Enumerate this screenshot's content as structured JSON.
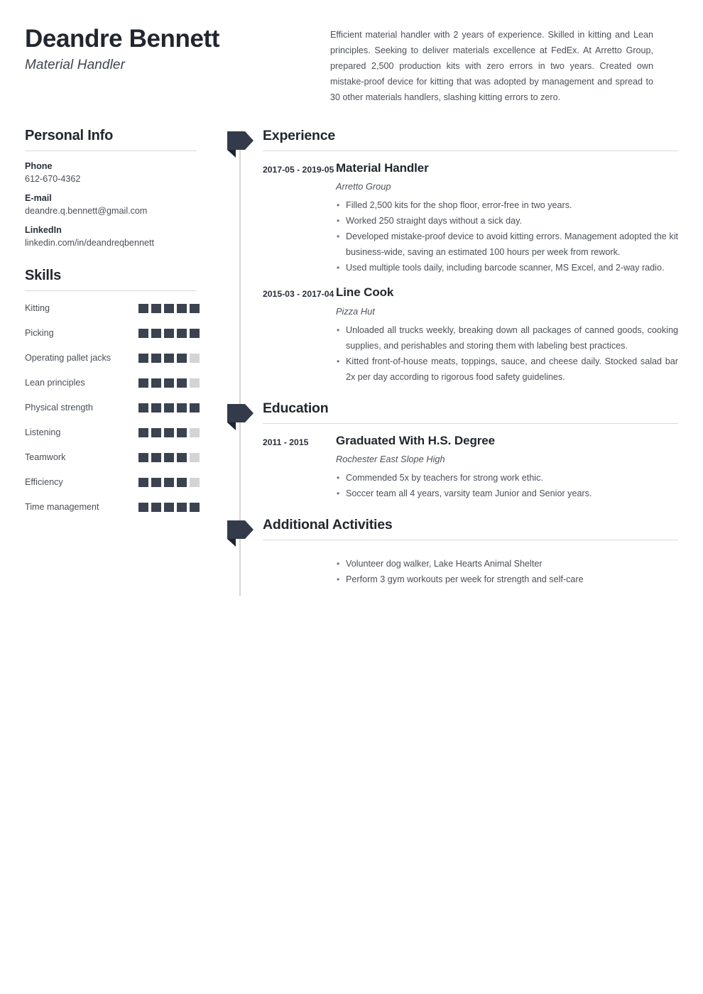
{
  "header": {
    "name": "Deandre Bennett",
    "job_title": "Material Handler",
    "summary": "Efficient material handler with 2 years of experience. Skilled in kitting and Lean principles. Seeking to deliver materials excellence at FedEx. At Arretto Group, prepared 2,500 production kits with zero errors in two years. Created own mistake-proof device for kitting that was adopted by management and spread to 30 other materials handlers, slashing kitting errors to zero."
  },
  "sidebar": {
    "personal_info": {
      "heading": "Personal Info",
      "fields": [
        {
          "label": "Phone",
          "value": "612-670-4362"
        },
        {
          "label": "E-mail",
          "value": "deandre.q.bennett@gmail.com"
        },
        {
          "label": "LinkedIn",
          "value": "linkedin.com/in/deandreqbennett"
        }
      ]
    },
    "skills": {
      "heading": "Skills",
      "max_level": 5,
      "items": [
        {
          "name": "Kitting",
          "level": 5
        },
        {
          "name": "Picking",
          "level": 5
        },
        {
          "name": "Operating pallet jacks",
          "level": 4
        },
        {
          "name": "Lean principles",
          "level": 4
        },
        {
          "name": "Physical strength",
          "level": 5
        },
        {
          "name": "Listening",
          "level": 4
        },
        {
          "name": "Teamwork",
          "level": 4
        },
        {
          "name": "Efficiency",
          "level": 4
        },
        {
          "name": "Time management",
          "level": 5
        }
      ]
    }
  },
  "main": {
    "experience": {
      "heading": "Experience",
      "entries": [
        {
          "dates": "2017-05 - 2019-05",
          "title": "Material Handler",
          "org": "Arretto Group",
          "bullets": [
            "Filled 2,500 kits for the shop floor, error-free in two years.",
            "Worked 250 straight days without a sick day.",
            "Developed mistake-proof device to avoid kitting errors. Management adopted the kit business-wide, saving an estimated 100 hours per week from rework.",
            "Used multiple tools daily, including barcode scanner, MS Excel, and 2-way radio."
          ]
        },
        {
          "dates": "2015-03 - 2017-04",
          "title": "Line Cook",
          "org": "Pizza Hut",
          "bullets": [
            "Unloaded all trucks weekly, breaking down all packages of canned goods, cooking supplies, and perishables and storing them with labeling best practices.",
            "Kitted front-of-house meats, toppings, sauce, and cheese daily. Stocked salad bar 2x per day according to rigorous food safety guidelines."
          ]
        }
      ]
    },
    "education": {
      "heading": "Education",
      "entries": [
        {
          "dates": "2011 - 2015",
          "title": "Graduated With H.S. Degree",
          "org": "Rochester East Slope High",
          "bullets": [
            "Commended 5x by teachers for strong work ethic.",
            "Soccer team all 4 years, varsity team Junior and Senior years."
          ]
        }
      ]
    },
    "additional_activities": {
      "heading": "Additional Activities",
      "bullets": [
        "Volunteer dog walker, Lake Hearts Animal Shelter",
        "Perform 3 gym workouts per week for strength and self-care"
      ]
    }
  },
  "colors": {
    "dark": "#22262e",
    "slate": "#3b4250",
    "muted_square": "#d2d4d5",
    "rule": "#d8dadd"
  }
}
